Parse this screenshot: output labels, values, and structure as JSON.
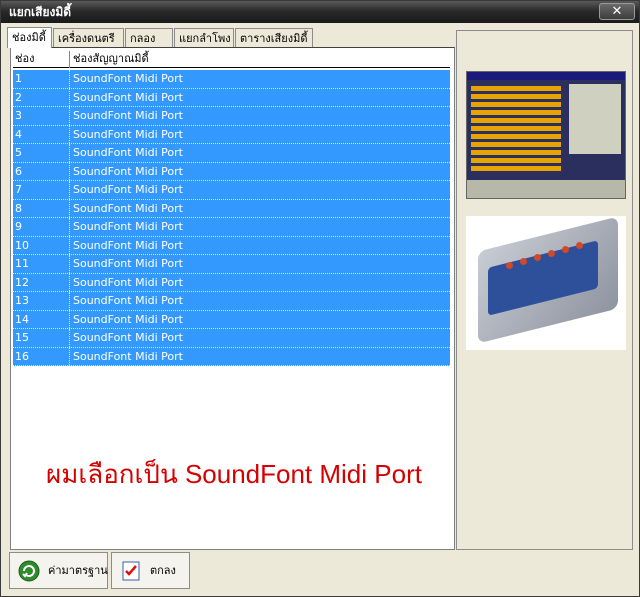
{
  "window": {
    "title": "แยกเสียงมิดี้",
    "close_label": "✕"
  },
  "tabs": [
    {
      "label": "ช่องมิดี้",
      "active": true
    },
    {
      "label": "เครื่องดนตรี",
      "active": false
    },
    {
      "label": "กลอง",
      "active": false
    },
    {
      "label": "แยกลำโพง",
      "active": false
    },
    {
      "label": "ตารางเสียงมิดี้",
      "active": false
    }
  ],
  "grid": {
    "headers": [
      "ช่อง",
      "ช่องสัญญาณมิดี้"
    ],
    "rows": [
      [
        "1",
        "SoundFont Midi Port"
      ],
      [
        "2",
        "SoundFont Midi Port"
      ],
      [
        "3",
        "SoundFont Midi Port"
      ],
      [
        "4",
        "SoundFont Midi Port"
      ],
      [
        "5",
        "SoundFont Midi Port"
      ],
      [
        "6",
        "SoundFont Midi Port"
      ],
      [
        "7",
        "SoundFont Midi Port"
      ],
      [
        "8",
        "SoundFont Midi Port"
      ],
      [
        "9",
        "SoundFont Midi Port"
      ],
      [
        "10",
        "SoundFont Midi Port"
      ],
      [
        "11",
        "SoundFont Midi Port"
      ],
      [
        "12",
        "SoundFont Midi Port"
      ],
      [
        "13",
        "SoundFont Midi Port"
      ],
      [
        "14",
        "SoundFont Midi Port"
      ],
      [
        "15",
        "SoundFont Midi Port"
      ],
      [
        "16",
        "SoundFont Midi Port"
      ]
    ]
  },
  "annotation": "ผมเลือกเป็น SoundFont Midi Port",
  "buttons": {
    "default_label": "ค่ามาตรฐาน",
    "ok_label": "ตกลง"
  },
  "colors": {
    "selection": "#3399ff",
    "annotation": "#d60000"
  }
}
